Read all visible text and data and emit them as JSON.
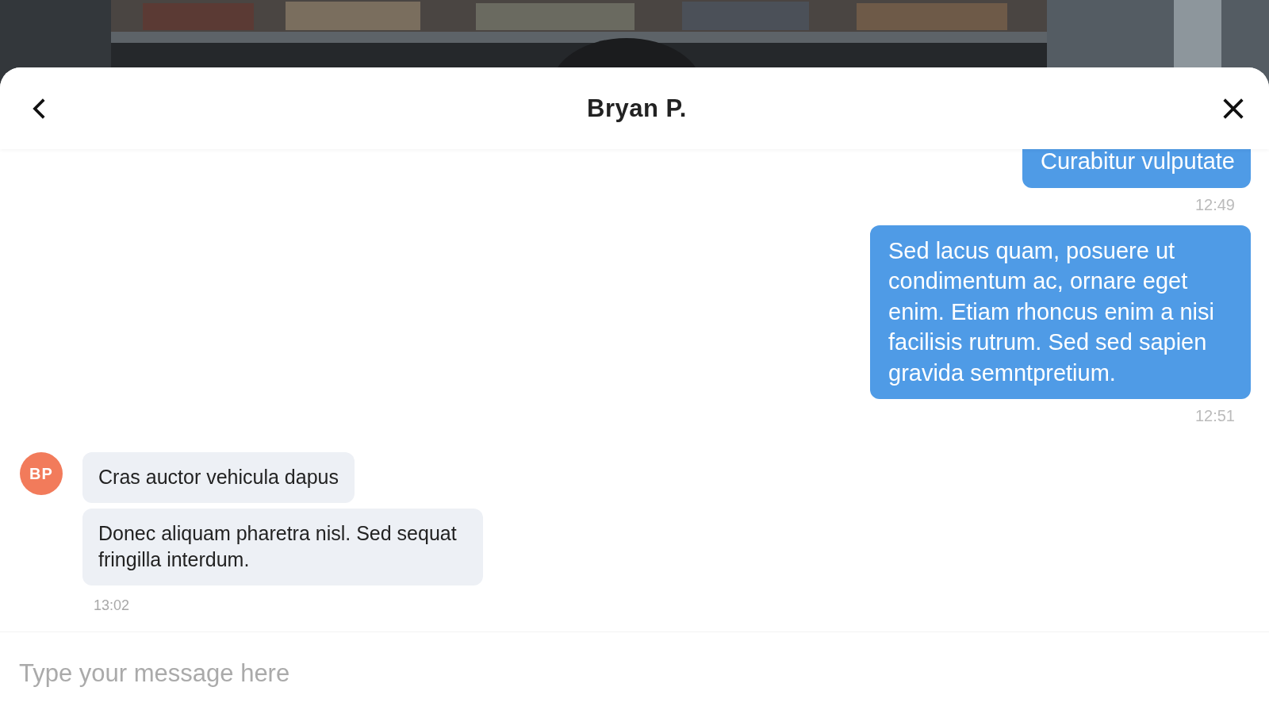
{
  "header": {
    "title": "Bryan P."
  },
  "messages": [
    {
      "kind": "sent",
      "bubbles": [
        "Curabitur vulputate"
      ],
      "time": "12:49"
    },
    {
      "kind": "sent",
      "bubbles": [
        "Sed lacus quam, posuere ut condimentum ac, ornare eget enim. Etiam rhoncus enim a nisi facilisis rutrum. Sed sed sapien gravida semntpretium."
      ],
      "time": "12:51"
    },
    {
      "kind": "received",
      "avatar": {
        "initials": "BP",
        "color": "#f27b5b"
      },
      "bubbles": [
        "Cras auctor vehicula dapus",
        "Donec aliquam pharetra nisl. Sed sequat fringilla interdum."
      ],
      "time": "13:02"
    }
  ],
  "composer": {
    "placeholder": "Type your message here"
  }
}
